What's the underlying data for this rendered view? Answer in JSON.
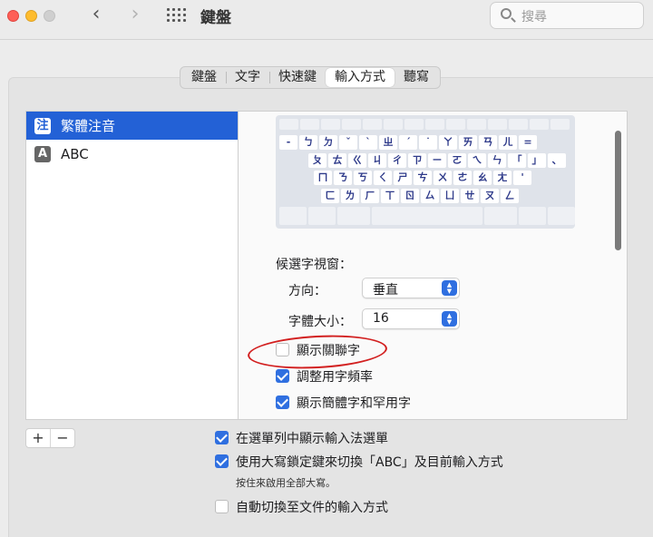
{
  "window": {
    "title": "鍵盤"
  },
  "search": {
    "placeholder": "搜尋"
  },
  "nav": {
    "back_glyph": "‹",
    "forward_glyph": "›"
  },
  "tabs": [
    {
      "label": "鍵盤"
    },
    {
      "label": "文字"
    },
    {
      "label": "快速鍵"
    },
    {
      "label": "輸入方式",
      "selected": true
    },
    {
      "label": "聽寫"
    }
  ],
  "sources": [
    {
      "badge": "注",
      "label": "繁體注音",
      "selected": true
    },
    {
      "badge": "A",
      "label": "ABC",
      "selected": false
    }
  ],
  "keyboard": {
    "rows": [
      [
        "",
        "",
        "",
        "",
        "",
        "",
        "",
        "",
        "",
        "",
        "",
        "",
        "",
        ""
      ],
      [
        "-",
        "ㄅ",
        "ㄉ",
        "ˇ",
        "ˋ",
        "ㄓ",
        "ˊ",
        "˙",
        "ㄚ",
        "ㄞ",
        "ㄢ",
        "ㄦ",
        "="
      ],
      [
        "ㄆ",
        "ㄊ",
        "ㄍ",
        "ㄐ",
        "ㄔ",
        "ㄗ",
        "ㄧ",
        "ㄛ",
        "ㄟ",
        "ㄣ",
        "「",
        "」",
        "、"
      ],
      [
        "ㄇ",
        "ㄋ",
        "ㄎ",
        "ㄑ",
        "ㄕ",
        "ㄘ",
        "ㄨ",
        "ㄜ",
        "ㄠ",
        "ㄤ",
        "'"
      ],
      [
        "ㄈ",
        "ㄌ",
        "ㄏ",
        "ㄒ",
        "ㄖ",
        "ㄙ",
        "ㄩ",
        "ㄝ",
        "ㄡ",
        "ㄥ"
      ]
    ]
  },
  "candidate_window": {
    "heading": "候選字視窗：",
    "direction_label": "方向：",
    "direction_value": "垂直",
    "font_size_label": "字體大小：",
    "font_size_value": "16"
  },
  "options": {
    "show_associated": {
      "label": "顯示關聯字",
      "checked": false
    },
    "adjust_frequency": {
      "label": "調整用字頻率",
      "checked": true
    },
    "show_simplified_rare": {
      "label": "顯示簡體字和罕用字",
      "checked": true
    }
  },
  "list_controls": {
    "add": "+",
    "remove": "−"
  },
  "global_options": {
    "show_in_menubar": {
      "label": "在選單列中顯示輸入法選單",
      "checked": true
    },
    "caps_lock_switch": {
      "label": "使用大寫鎖定鍵來切換「ABC」及目前輸入方式",
      "checked": true,
      "note": "按住來啟用全部大寫。"
    },
    "auto_switch": {
      "label": "自動切換至文件的輸入方式",
      "checked": false
    }
  },
  "colors": {
    "accent": "#2f6fe0",
    "selection": "#2361d6",
    "annotation": "#d21f1f"
  }
}
